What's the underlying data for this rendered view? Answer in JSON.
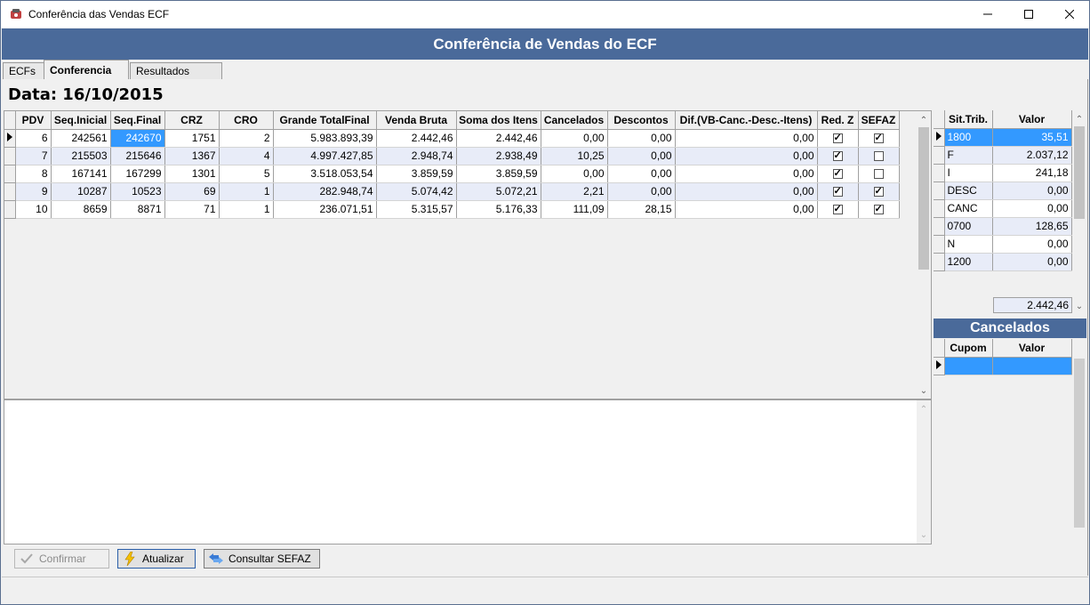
{
  "window": {
    "title": "Conferência das Vendas ECF"
  },
  "header": {
    "title": "Conferência de Vendas do ECF"
  },
  "tabs": [
    {
      "label": "ECFs"
    },
    {
      "label": "Conferencia"
    },
    {
      "label": "Resultados"
    }
  ],
  "date_label": "Data: 16/10/2015",
  "main_grid": {
    "columns": [
      "PDV",
      "Seq.Inicial",
      "Seq.Final",
      "CRZ",
      "CRO",
      "Grande TotalFinal",
      "Venda Bruta",
      "Soma dos Itens",
      "Cancelados",
      "Descontos",
      "Dif.(VB-Canc.-Desc.-Itens)",
      "Red. Z",
      "SEFAZ"
    ],
    "rows": [
      {
        "pdv": "6",
        "seq_ini": "242561",
        "seq_fim": "242670",
        "crz": "1751",
        "cro": "2",
        "gt": "5.983.893,39",
        "vb": "2.442,46",
        "soma": "2.442,46",
        "canc": "0,00",
        "desc": "0,00",
        "dif": "0,00",
        "redz": true,
        "sefaz": true
      },
      {
        "pdv": "7",
        "seq_ini": "215503",
        "seq_fim": "215646",
        "crz": "1367",
        "cro": "4",
        "gt": "4.997.427,85",
        "vb": "2.948,74",
        "soma": "2.938,49",
        "canc": "10,25",
        "desc": "0,00",
        "dif": "0,00",
        "redz": true,
        "sefaz": false
      },
      {
        "pdv": "8",
        "seq_ini": "167141",
        "seq_fim": "167299",
        "crz": "1301",
        "cro": "5",
        "gt": "3.518.053,54",
        "vb": "3.859,59",
        "soma": "3.859,59",
        "canc": "0,00",
        "desc": "0,00",
        "dif": "0,00",
        "redz": true,
        "sefaz": false
      },
      {
        "pdv": "9",
        "seq_ini": "10287",
        "seq_fim": "10523",
        "crz": "69",
        "cro": "1",
        "gt": "282.948,74",
        "vb": "5.074,42",
        "soma": "5.072,21",
        "canc": "2,21",
        "desc": "0,00",
        "dif": "0,00",
        "redz": true,
        "sefaz": true
      },
      {
        "pdv": "10",
        "seq_ini": "8659",
        "seq_fim": "8871",
        "crz": "71",
        "cro": "1",
        "gt": "236.071,51",
        "vb": "5.315,57",
        "soma": "5.176,33",
        "canc": "111,09",
        "desc": "28,15",
        "dif": "0,00",
        "redz": true,
        "sefaz": true
      }
    ]
  },
  "trib_grid": {
    "columns": [
      "Sit.Trib.",
      "Valor"
    ],
    "rows": [
      {
        "sit": "1800",
        "valor": "35,51"
      },
      {
        "sit": "F",
        "valor": "2.037,12"
      },
      {
        "sit": "I",
        "valor": "241,18"
      },
      {
        "sit": "DESC",
        "valor": "0,00"
      },
      {
        "sit": "CANC",
        "valor": "0,00"
      },
      {
        "sit": "0700",
        "valor": "128,65"
      },
      {
        "sit": "N",
        "valor": "0,00"
      },
      {
        "sit": "1200",
        "valor": "0,00"
      }
    ],
    "total": "2.442,46"
  },
  "cancelados": {
    "title": "Cancelados",
    "columns": [
      "Cupom",
      "Valor"
    ]
  },
  "buttons": {
    "confirm": "Confirmar",
    "update": "Atualizar",
    "sefaz": "Consultar SEFAZ"
  },
  "colors": {
    "header_band": "#4a6a9a",
    "selection": "#3399ff",
    "alt_row": "#e8ecf8"
  },
  "icons": [
    "app-icon",
    "minimize-icon",
    "maximize-icon",
    "close-icon",
    "row-pointer-icon",
    "check-icon",
    "lightning-icon",
    "arrows-icon"
  ]
}
